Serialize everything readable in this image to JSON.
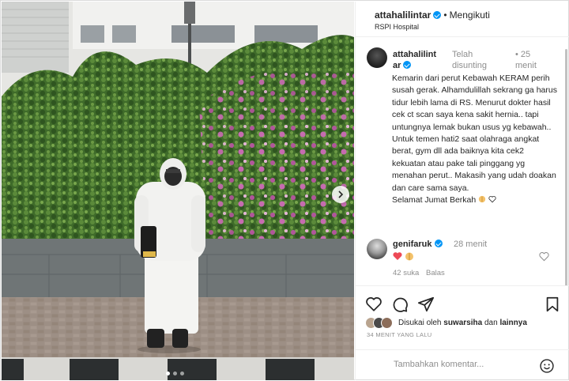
{
  "header": {
    "username": "attahalilintar",
    "separator": "•",
    "follow_label": "Mengikuti",
    "location": "RSPI Hospital"
  },
  "caption": {
    "username": "attahalilintar",
    "status": "Telah disunting",
    "time_dot": "•",
    "time": "25 menit",
    "lines": [
      "Kemarin dari perut Kebawah KERAM perih susah gerak. Alhamdulillah sekrang ga harus tidur lebih lama di RS. Menurut dokter hasil cek ct scan saya kena sakit hernia.. tapi untungnya lemak bukan usus yg kebawah..",
      "Untuk temen hati2 saat olahraga angkat berat, gym dll ada baiknya kita cek2 kekuatan atau pake tali pinggang yg menahan perut.. Makasih yang udah doakan dan care sama saya.",
      "Selamat Jumat Berkah"
    ]
  },
  "comment": {
    "username": "genifaruk",
    "time": "28 menit",
    "likes": "42 suka",
    "reply_label": "Balas"
  },
  "likes": {
    "prefix": "Disukai oleh",
    "user": "suwarsiha",
    "conjunction": "dan",
    "others": "lainnya"
  },
  "post_time": "34 MENIT YANG LALU",
  "comment_input": {
    "placeholder": "Tambahkan komentar..."
  },
  "icons": {
    "like": "heart-icon",
    "comment": "comment-icon",
    "share": "send-icon",
    "save": "bookmark-icon",
    "emoji": "emoji-icon",
    "next": "chevron-right-icon"
  },
  "colors": {
    "verified": "#0095f6",
    "heart_red": "#ed4956",
    "muted": "#8e8e8e"
  }
}
